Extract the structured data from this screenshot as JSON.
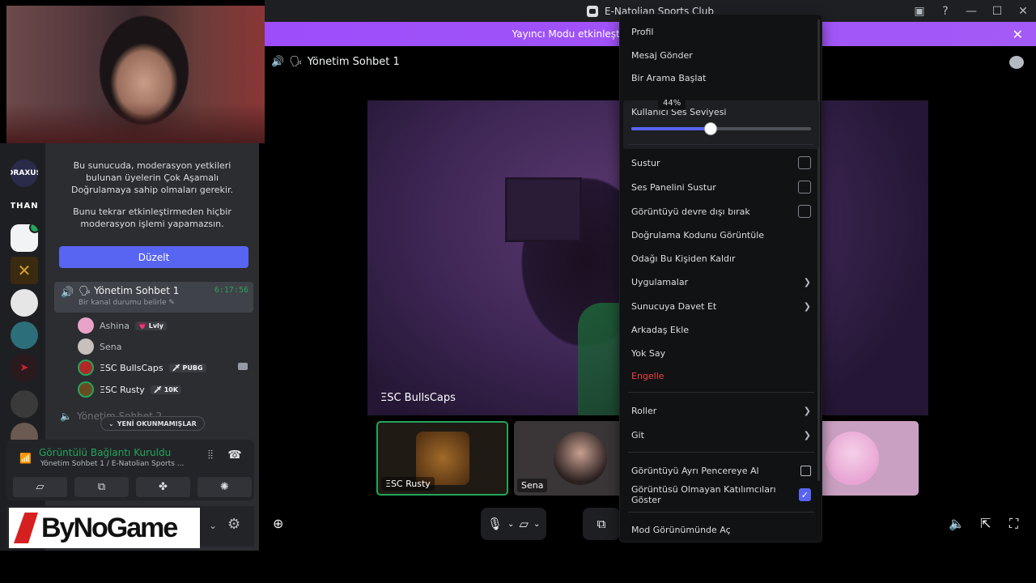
{
  "window": {
    "title": "E-Natolian Sports Club"
  },
  "banner": {
    "text": "Yayıncı Modu etkinleştirildi. Kullanıcı adları kısaltıldı.",
    "button_label": "D"
  },
  "sidebar": {
    "servers": [
      {
        "name": "Draxus",
        "label": "DRAXUS",
        "color": "#2a2a4a"
      },
      {
        "name": "Than",
        "label": "THAN",
        "color": "#1e1f22"
      },
      {
        "name": "E-Natolian",
        "label": "",
        "color": "#f2f3f5"
      },
      {
        "name": "Gold",
        "label": "",
        "color": "#3a2a10"
      },
      {
        "name": "Char1",
        "label": "",
        "color": "#e6e6e6"
      },
      {
        "name": "Char2",
        "label": "",
        "color": "#2c6e7a"
      },
      {
        "name": "Red",
        "label": "",
        "color": "#2a1a1e"
      },
      {
        "name": "Dark",
        "label": "",
        "color": "#3a3a3a"
      }
    ]
  },
  "channels": {
    "mfa_notice_1": "Bu sunucuda, moderasyon yetkileri bulunan üyelerin Çok Aşamalı Doğrulamaya sahip olmaları gerekir.",
    "mfa_notice_2": "Bunu tekrar etkinleştirmeden hiçbir moderasyon işlemi yapamazsın.",
    "edit_button": "Düzelt",
    "active_channel": {
      "name": "Yönetim Sohbet 1",
      "timer": "6:17:56",
      "status_placeholder": "Bir kanal durumu belirle"
    },
    "users": [
      {
        "name": "Ashina",
        "tag": "💗 Lvly",
        "color": "#e8a4c8",
        "bright": false
      },
      {
        "name": "Sena",
        "tag": "",
        "color": "#c8c0bc",
        "bright": false
      },
      {
        "name": "ΞSC BullsCaps",
        "tag": "🗡 PUBG",
        "color": "#b02828",
        "bright": true
      },
      {
        "name": "ΞSC Rusty",
        "tag": "🗡 10K",
        "color": "#6a4a20",
        "bright": true
      }
    ],
    "other_channel": "Yönetim Sohbet 2",
    "unread_pill": "YENİ OKUNMAMIŞLAR"
  },
  "voice": {
    "connected": "Görüntülü Bağlantı Kuruldu",
    "location": "Yönetim Sohbet 1 / E-Natolian Sports ..."
  },
  "user_panel": {
    "brand": "ByNoGame"
  },
  "stage": {
    "channel_name": "Yönetim Sohbet 1",
    "main_video_name": "ΞSC BullsCaps",
    "tiles": [
      {
        "name": "ΞSC Rusty",
        "color": "#201a14",
        "avatar": "#7a4a18",
        "active": true
      },
      {
        "name": "Sena",
        "color": "#3a3638",
        "avatar": "#2a2020",
        "active": false
      },
      {
        "name": "",
        "color": "#caa0c2",
        "avatar": "#e8a4d4",
        "active": false
      }
    ]
  },
  "context_menu": {
    "profile": "Profil",
    "send_message": "Mesaj Gönder",
    "start_call": "Bir Arama Başlat",
    "volume_label": "Kullanıcı Ses Seviyesi",
    "volume_percent": 44,
    "volume_tooltip": "44%",
    "mute": "Sustur",
    "mute_soundboard": "Ses Panelini Sustur",
    "disable_video": "Görüntüyü devre dışı bırak",
    "verify_code": "Doğrulama Kodunu Görüntüle",
    "remove_focus": "Odağı Bu Kişiden Kaldır",
    "apps": "Uygulamalar",
    "invite_server": "Sunucuya Davet Et",
    "add_friend": "Arkadaş Ekle",
    "ignore": "Yok Say",
    "block": "Engelle",
    "roles": "Roller",
    "go": "Git",
    "popout": "Görüntüyü Ayrı Pencereye Al",
    "show_nonvideo": "Görüntüsü Olmayan Katılımcıları Göster",
    "show_nonvideo_checked": true,
    "mod_view": "Mod Görünümünde Aç"
  }
}
